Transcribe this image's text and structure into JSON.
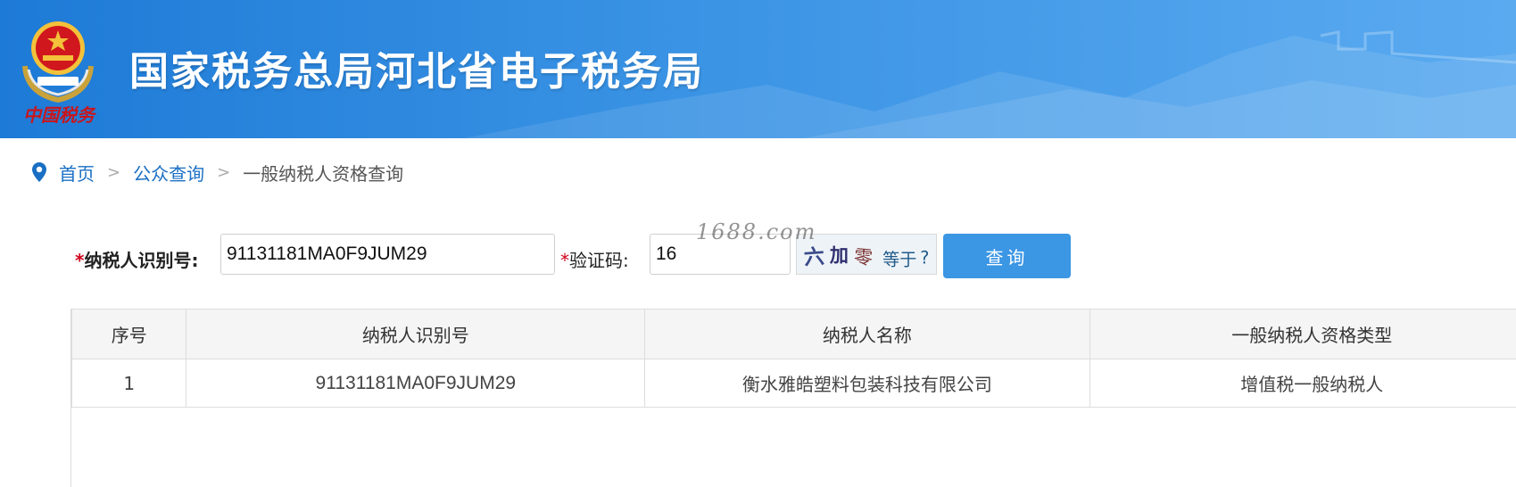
{
  "header": {
    "title": "国家税务总局河北省电子税务局",
    "seal_text": "中国税务",
    "colors": {
      "banner_start": "#1d7ad6",
      "banner_end": "#5aaaf0"
    }
  },
  "breadcrumb": {
    "home": "首页",
    "separator": ">",
    "public_query": "公众查询",
    "current": "一般纳税人资格查询"
  },
  "form": {
    "star": "*",
    "taxid_label": "纳税人识别号:",
    "taxid_value": "91131181MA0F9JUM29",
    "captcha_label": "验证码:",
    "captcha_value": "16",
    "captcha_image_text": "六加零等于?",
    "query_button": "查询",
    "button_color": "#3b96e4"
  },
  "watermark": "1688.com",
  "table": {
    "headers": [
      "序号",
      "纳税人识别号",
      "纳税人名称",
      "一般纳税人资格类型"
    ],
    "rows": [
      [
        "1",
        "91131181MA0F9JUM29",
        "衡水雅皓塑料包装科技有限公司",
        "增值税一般纳税人"
      ]
    ]
  }
}
